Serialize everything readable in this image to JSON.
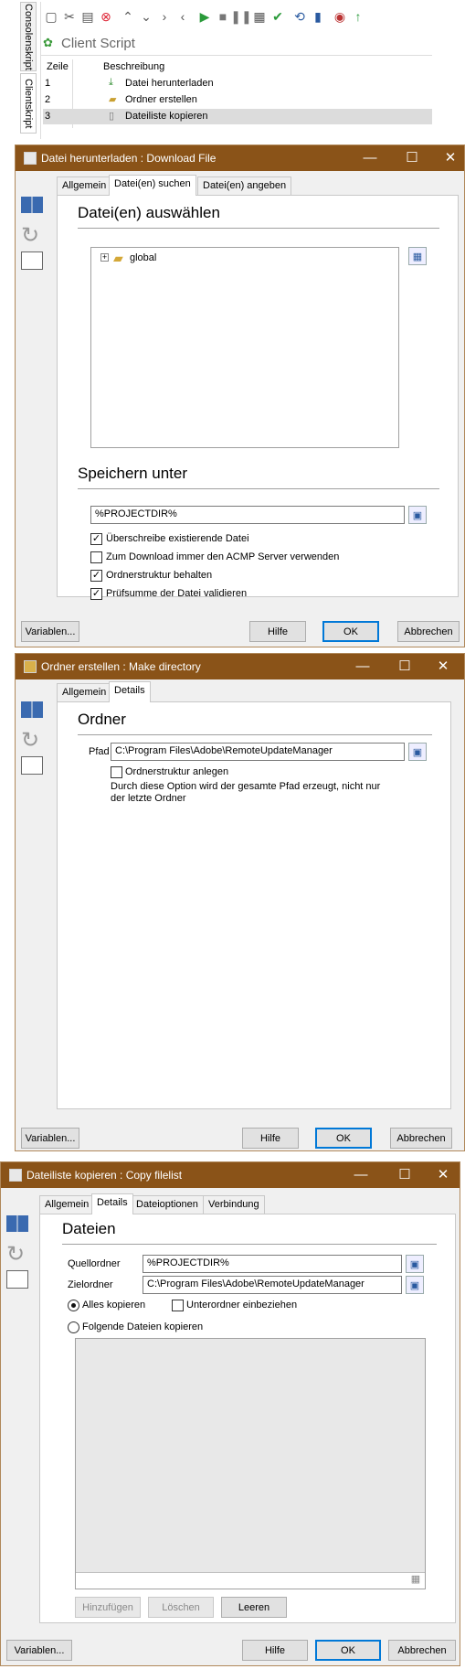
{
  "script_panel": {
    "vtab_console": "Consolenskript",
    "vtab_client": "Clientskript",
    "title": "Client Script",
    "col_line": "Zeile",
    "col_desc": "Beschreibung",
    "rows": [
      {
        "line": "1",
        "desc": "Datei herunterladen"
      },
      {
        "line": "2",
        "desc": "Ordner erstellen"
      },
      {
        "line": "3",
        "desc": "Dateiliste kopieren"
      }
    ],
    "toolbar_icons": [
      "new-icon",
      "cut-icon",
      "paste-icon",
      "delete-icon",
      "up-icon",
      "down-icon",
      "indent-right-icon",
      "indent-left-icon",
      "play-icon",
      "stop-icon",
      "pause-icon",
      "report-icon",
      "check-icon",
      "scan-icon",
      "chart-icon",
      "record-icon",
      "upload-icon"
    ]
  },
  "dlg1": {
    "title": "Datei herunterladen : Download File",
    "tabs": [
      "Allgemein",
      "Datei(en) suchen",
      "Datei(en) angeben"
    ],
    "section1": "Datei(en) auswählen",
    "tree_item": "global",
    "section2": "Speichern unter",
    "save_path": "%PROJECTDIR%",
    "checkboxes": [
      {
        "label": "Überschreibe existierende Datei",
        "checked": true
      },
      {
        "label": "Zum Download immer den ACMP Server verwenden",
        "checked": false
      },
      {
        "label": "Ordnerstruktur behalten",
        "checked": true
      },
      {
        "label": "Prüfsumme der Datei validieren",
        "checked": true
      }
    ],
    "btn_vars": "Variablen...",
    "btn_help": "Hilfe",
    "btn_ok": "OK",
    "btn_cancel": "Abbrechen"
  },
  "dlg2": {
    "title": "Ordner erstellen : Make directory",
    "tabs": [
      "Allgemein",
      "Details"
    ],
    "section": "Ordner",
    "path_label": "Pfad",
    "path_value": "C:\\Program Files\\Adobe\\RemoteUpdateManager",
    "cb_label": "Ordnerstruktur anlegen",
    "hint": "Durch diese Option wird der gesamte Pfad erzeugt, nicht nur der letzte Ordner",
    "btn_vars": "Variablen...",
    "btn_help": "Hilfe",
    "btn_ok": "OK",
    "btn_cancel": "Abbrechen"
  },
  "dlg3": {
    "title": "Dateiliste kopieren : Copy filelist",
    "tabs": [
      "Allgemein",
      "Details",
      "Dateioptionen",
      "Verbindung"
    ],
    "section": "Dateien",
    "src_label": "Quellordner",
    "src_value": "%PROJECTDIR%",
    "dst_label": "Zielordner",
    "dst_value": "C:\\Program Files\\Adobe\\RemoteUpdateManager",
    "radio_all": "Alles kopieren",
    "cb_sub": "Unterordner einbeziehen",
    "radio_following": "Folgende Dateien kopieren",
    "btn_add": "Hinzufügen",
    "btn_remove": "Löschen",
    "btn_clear": "Leeren",
    "btn_vars": "Variablen...",
    "btn_help": "Hilfe",
    "btn_ok": "OK",
    "btn_cancel": "Abbrechen"
  }
}
